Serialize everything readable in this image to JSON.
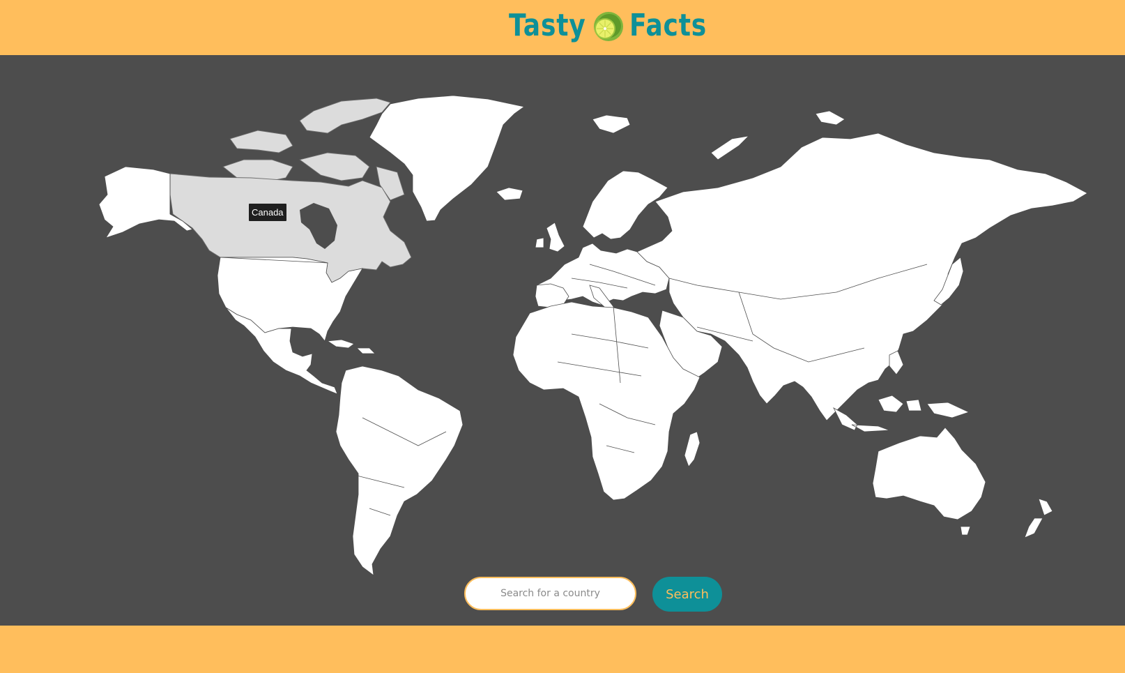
{
  "header": {
    "logo_word_1": "Tasty",
    "logo_word_2": "Facts",
    "logo_icon": "lime-icon"
  },
  "map": {
    "highlighted_country": "Canada",
    "tooltip_label": "Canada"
  },
  "search": {
    "placeholder": "Search for a country",
    "button_label": "Search"
  },
  "colors": {
    "brand_orange": "#FFBE5C",
    "brand_teal": "#0E9098",
    "map_background": "#4D4D4D",
    "land": "#FFFFFF",
    "land_highlight": "#DCDCDC"
  }
}
